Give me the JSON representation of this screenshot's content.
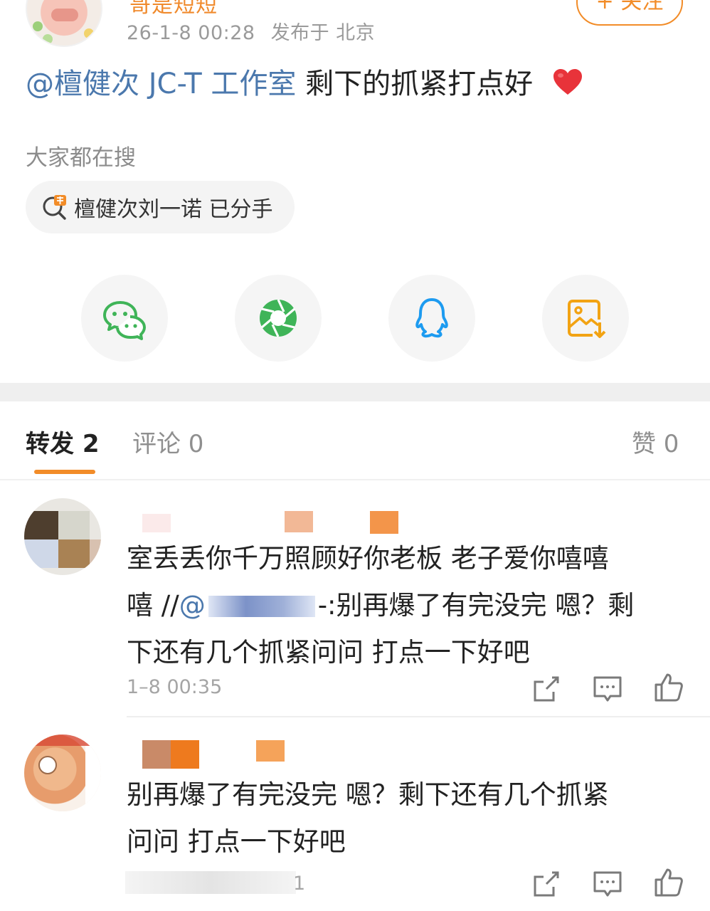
{
  "header": {
    "username": "哥是短短",
    "time": "26-1-8 00:28",
    "location": "发布于 北京",
    "follow_label": "+ 关注"
  },
  "post": {
    "mention": "@檀健次 JC-T 工作室",
    "text": " 剩下的抓紧打点好 "
  },
  "search": {
    "title": "大家都在搜",
    "hot_topic": "檀健次刘一诺 已分手"
  },
  "share": {
    "items": [
      "wechat-icon",
      "moments-icon",
      "qq-icon",
      "save-image-icon"
    ]
  },
  "tabs": {
    "repost": "转发 2",
    "comment": "评论 0",
    "like": "赞 0"
  },
  "comments": [
    {
      "line1": "室丢丢你千万照顾好你老板 老子爱你嘻嘻",
      "line2_prefix": "嘻 //",
      "line2_mention": "@",
      "line2_suffix": "-:别再爆了有完没完 嗯？剩",
      "line3": "下还有几个抓紧问问 打点一下好吧",
      "time": "1–8 00:35"
    },
    {
      "line1": "别再爆了有完没完 嗯？剩下还有几个抓紧",
      "line2": "问问 打点一下好吧",
      "time_tail": "1"
    }
  ],
  "colors": {
    "accent": "#f28c28",
    "link": "#4b78ad",
    "muted": "#9a9a9a"
  }
}
